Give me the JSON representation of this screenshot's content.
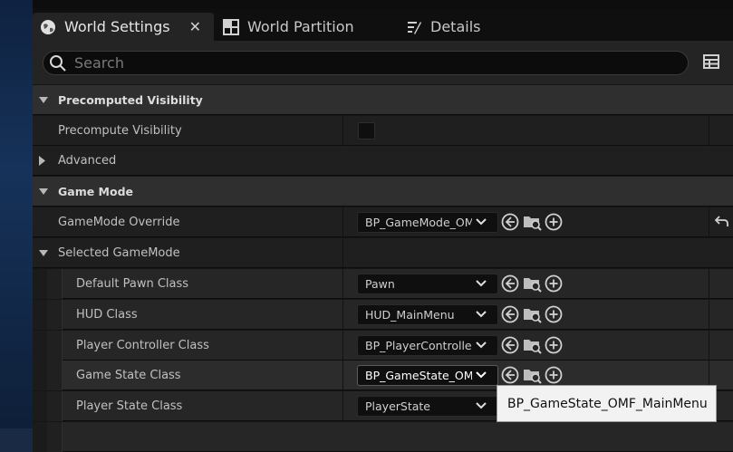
{
  "tabs": [
    {
      "label": "World Settings",
      "icon": "globe-icon",
      "active": true
    },
    {
      "label": "World Partition",
      "icon": "grid-icon",
      "active": false
    },
    {
      "label": "Details",
      "icon": "details-icon",
      "active": false
    }
  ],
  "search": {
    "placeholder": "Search"
  },
  "rows": {
    "precomputed_visibility": "Precomputed Visibility",
    "precompute_visibility": "Precompute Visibility",
    "advanced": "Advanced",
    "game_mode": "Game Mode",
    "gamemode_override": {
      "label": "GameMode Override",
      "value": "BP_GameMode_OMF_MainMenu"
    },
    "selected_gamemode": "Selected GameMode",
    "default_pawn_class": {
      "label": "Default Pawn Class",
      "value": "Pawn"
    },
    "hud_class": {
      "label": "HUD Class",
      "value": "HUD_MainMenu"
    },
    "player_controller_class": {
      "label": "Player Controller Class",
      "value": "BP_PlayerController_OMF"
    },
    "game_state_class": {
      "label": "Game State Class",
      "value": "BP_GameState_OMF_MainMenu"
    },
    "player_state_class": {
      "label": "Player State Class",
      "value": "PlayerState"
    }
  },
  "tooltip": "BP_GameState_OMF_MainMenu",
  "colors": {
    "panel": "#151515",
    "category": "#2f2f2f",
    "property": "#1f1f1f",
    "tooltip": "#f2f2f2"
  }
}
